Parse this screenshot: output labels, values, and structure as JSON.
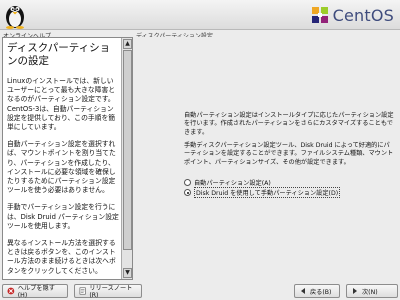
{
  "header": {
    "logo_text": "CentOS"
  },
  "sections": {
    "help_label": "オンラインヘルプ",
    "main_label": "ディスクパーティション設定"
  },
  "help": {
    "title": "ディスクパーティションの設定",
    "paragraphs": [
      "Linuxのインストールでは、新しいユーザーにとって最も大きな障害となるのがパーティション設定です。CentOS-3は、自動パーティション設定を提供しており、この手順を簡単にしています。",
      "自動パーティション設定を選択すれば、マウントポイントを割り当てたり、パーティションを作成したり、インストールに必要な領域を確保したりするためにパーティション設定ツールを使う必要はありません。",
      "手動でパーティション設定を行うには、Disk Druid パーティション設定ツールを使用します。",
      "異なるインストール方法を選択するときは戻るボタンを、このインストール方法のまま続けるときは次へボタンをクリックしてください。"
    ]
  },
  "main": {
    "text1": "自動パーティション設定はインストールタイプに応じたパーティション設定を行います。作成されたパーティションをさらにカスタマイズすることもできます。",
    "text2": "手動ディスクパーティション設定ツール、Disk Druid によって好適的にパーティションを設定することができます。ファイルシステム種類、マウントポイント、パーティションサイズ、その他が設定できます。",
    "options": [
      {
        "label": "自動パーティション設定(A)",
        "checked": false
      },
      {
        "label": "Disk Druid を使用して手動パーティション設定(D)",
        "checked": true
      }
    ]
  },
  "buttons": {
    "help": "ヘルプを隠す(H)",
    "notes": "リリースノート(R)",
    "back": "戻る(B)",
    "next": "次(N)"
  }
}
